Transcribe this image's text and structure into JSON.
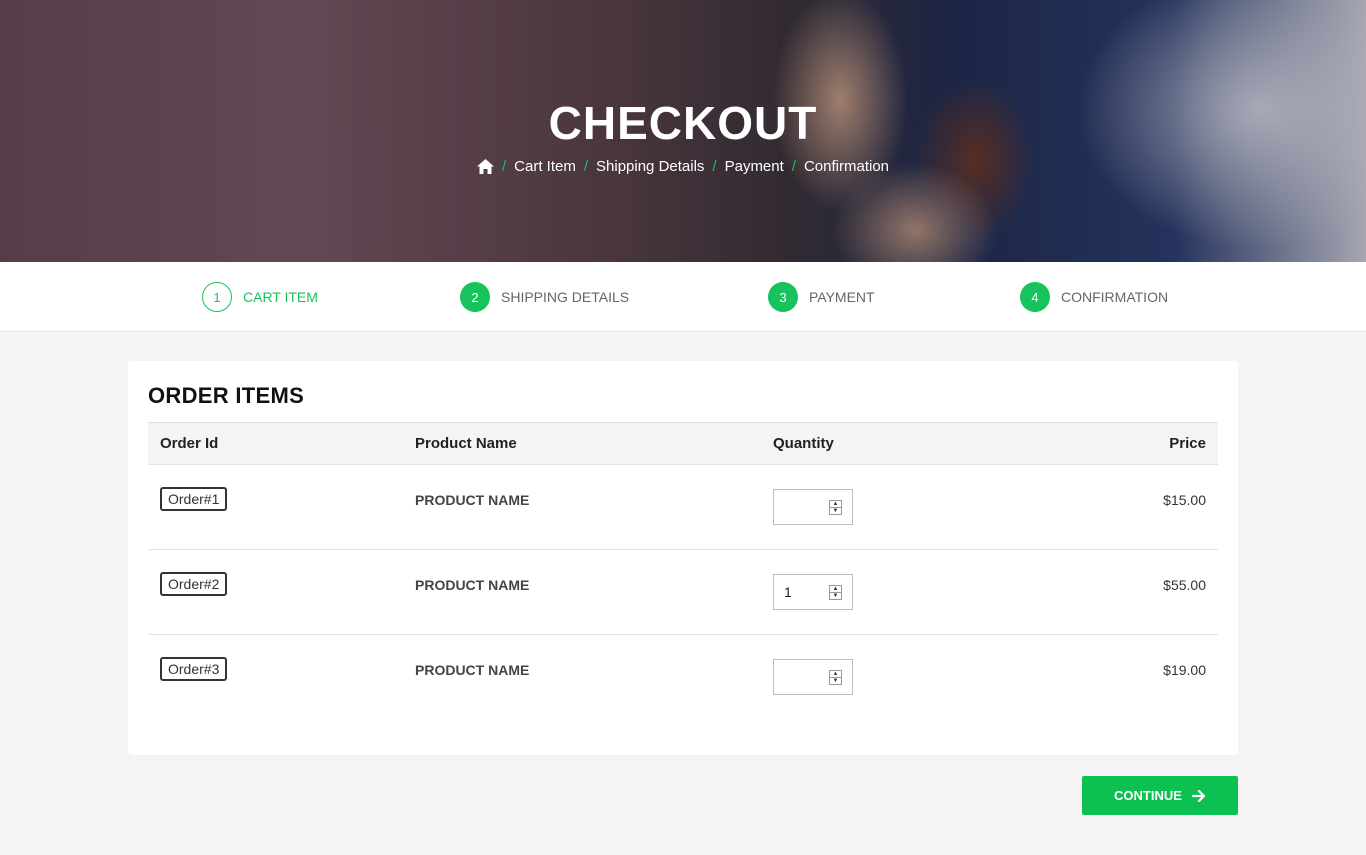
{
  "hero": {
    "title": "CHECKOUT",
    "breadcrumb": [
      "Cart Item",
      "Shipping Details",
      "Payment",
      "Confirmation"
    ]
  },
  "steps": [
    {
      "num": "1",
      "label": "CART ITEM",
      "active": true
    },
    {
      "num": "2",
      "label": "SHIPPING DETAILS",
      "active": false
    },
    {
      "num": "3",
      "label": "PAYMENT",
      "active": false
    },
    {
      "num": "4",
      "label": "CONFIRMATION",
      "active": false
    }
  ],
  "order": {
    "title": "ORDER ITEMS",
    "columns": [
      "Order Id",
      "Product Name",
      "Quantity",
      "Price"
    ],
    "rows": [
      {
        "id": "Order#1",
        "product": "PRODUCT NAME",
        "quantity": "",
        "price": "$15.00"
      },
      {
        "id": "Order#2",
        "product": "PRODUCT NAME",
        "quantity": "1",
        "price": "$55.00"
      },
      {
        "id": "Order#3",
        "product": "PRODUCT NAME",
        "quantity": "",
        "price": "$19.00"
      }
    ]
  },
  "actions": {
    "continue_label": "CONTINUE"
  },
  "colors": {
    "accent": "#0cc152"
  },
  "icons": {
    "home": "home-icon",
    "arrow": "arrow-right-icon",
    "spinner": "spinner-icon"
  }
}
